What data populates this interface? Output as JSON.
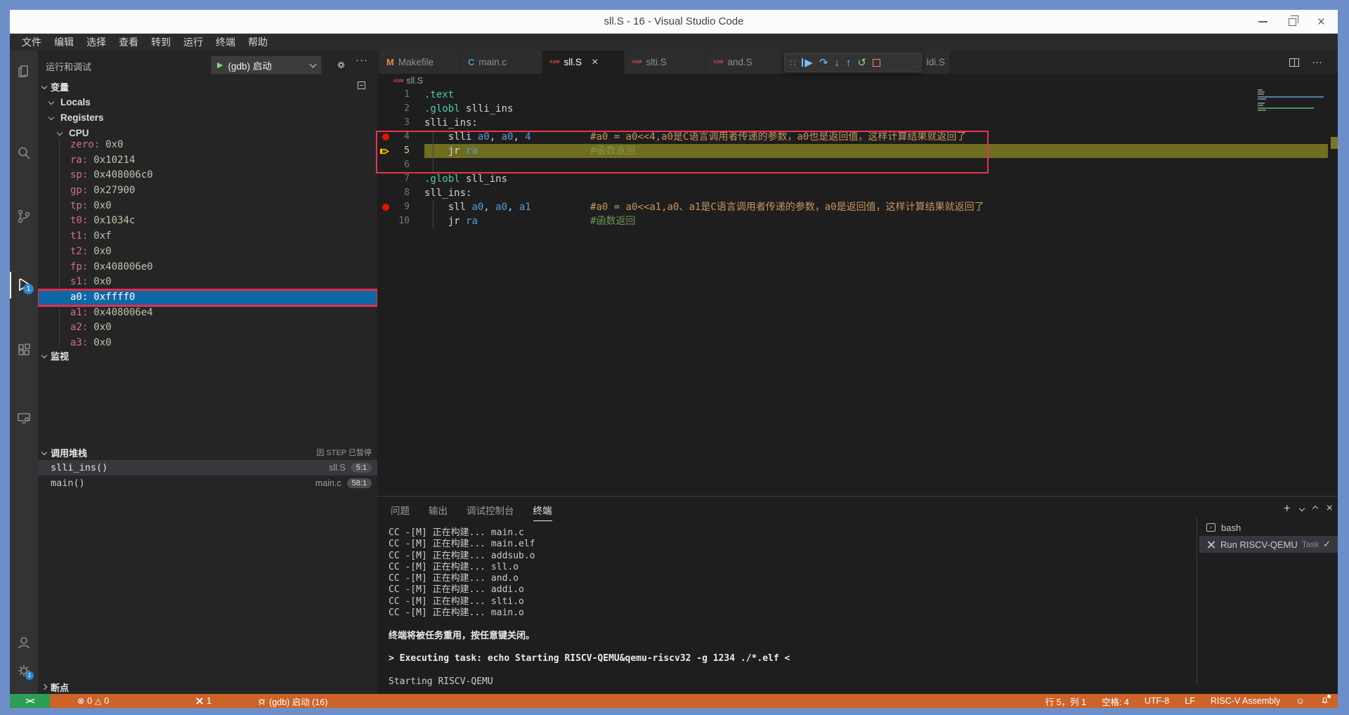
{
  "window": {
    "title": "sll.S - 16 - Visual Studio Code"
  },
  "menu": [
    "文件",
    "编辑",
    "选择",
    "查看",
    "转到",
    "运行",
    "终端",
    "帮助"
  ],
  "activity": {
    "debug_badge": "1",
    "settings_badge": "1"
  },
  "sidebar": {
    "title": "运行和调试",
    "launch": {
      "label": "(gdb) 启动"
    },
    "variables": {
      "title": "变量",
      "tree": [
        "Locals",
        "Registers"
      ],
      "cpu": "CPU",
      "registers": [
        [
          "zero",
          "0x0"
        ],
        [
          "ra",
          "0x10214"
        ],
        [
          "sp",
          "0x408006c0"
        ],
        [
          "gp",
          "0x27900"
        ],
        [
          "tp",
          "0x0"
        ],
        [
          "t0",
          "0x1034c"
        ],
        [
          "t1",
          "0xf"
        ],
        [
          "t2",
          "0x0"
        ],
        [
          "fp",
          "0x408006e0"
        ],
        [
          "s1",
          "0x0"
        ],
        [
          "a0",
          "0xffff0"
        ],
        [
          "a1",
          "0x408006e4"
        ],
        [
          "a2",
          "0x0"
        ],
        [
          "a3",
          "0x0"
        ]
      ],
      "selected": "a0"
    },
    "watch": {
      "title": "监视"
    },
    "call_stack": {
      "title": "调用堆栈",
      "paused_reason": "因 STEP 已暂停",
      "frames": [
        {
          "fn": "slli_ins()",
          "file": "sll.S",
          "pos": "5:1"
        },
        {
          "fn": "main()",
          "file": "main.c",
          "pos": "58:1"
        }
      ]
    },
    "breakpoints": {
      "title": "断点"
    }
  },
  "tabs": [
    {
      "icon": "M",
      "label": "Makefile"
    },
    {
      "icon": "C",
      "label": "main.c"
    },
    {
      "icon": "ASM",
      "label": "sll.S",
      "active": true
    },
    {
      "icon": "ASM",
      "label": "slti.S"
    },
    {
      "icon": "ASM",
      "label": "and.S"
    },
    {
      "icon": "ASM",
      "label": "ldi.S",
      "partial": true
    }
  ],
  "editor": {
    "breadcrumb": "sll.S",
    "lines": [
      {
        "n": 1,
        "segs": [
          [
            "dir",
            ".text"
          ]
        ]
      },
      {
        "n": 2,
        "segs": [
          [
            "dir",
            ".globl"
          ],
          [
            "pl",
            " slli_ins"
          ]
        ]
      },
      {
        "n": 3,
        "segs": [
          [
            "pl",
            "slli_ins:"
          ]
        ]
      },
      {
        "n": 4,
        "bp": true,
        "segs": [
          [
            "pl",
            "    slli "
          ],
          [
            "reg",
            "a0"
          ],
          [
            "pl",
            ", "
          ],
          [
            "reg",
            "a0"
          ],
          [
            "pl",
            ", "
          ],
          [
            "nm",
            "4"
          ],
          [
            "pl",
            "          "
          ],
          [
            "cmt1",
            "#a0 = a0<<4,a0是C语言调用者传递的参数，a0也是返回值，这样计算结果就返回了"
          ]
        ]
      },
      {
        "n": 5,
        "cur": true,
        "segs": [
          [
            "pl",
            "    jr "
          ],
          [
            "reg",
            "ra"
          ],
          [
            "pl",
            "                   "
          ],
          [
            "cmt2",
            "#函数返回"
          ]
        ]
      },
      {
        "n": 6,
        "segs": []
      },
      {
        "n": 7,
        "segs": [
          [
            "dir",
            ".globl"
          ],
          [
            "pl",
            " sll_ins"
          ]
        ]
      },
      {
        "n": 8,
        "segs": [
          [
            "pl",
            "sll_ins:"
          ]
        ]
      },
      {
        "n": 9,
        "bp": true,
        "segs": [
          [
            "pl",
            "    sll "
          ],
          [
            "reg",
            "a0"
          ],
          [
            "pl",
            ", "
          ],
          [
            "reg",
            "a0"
          ],
          [
            "pl",
            ", "
          ],
          [
            "reg",
            "a1"
          ],
          [
            "pl",
            "          "
          ],
          [
            "cmt1",
            "#a0 = a0<<a1,a0、a1是C语言调用者传递的参数，a0是返回值，这样计算结果就返回了"
          ]
        ]
      },
      {
        "n": 10,
        "segs": [
          [
            "pl",
            "    jr "
          ],
          [
            "reg",
            "ra"
          ],
          [
            "pl",
            "                   "
          ],
          [
            "cmt2",
            "#函数返回"
          ]
        ]
      }
    ]
  },
  "panel": {
    "tabs": [
      "问题",
      "输出",
      "调试控制台",
      "终端"
    ],
    "active_tab": "终端",
    "terminal": {
      "lines": [
        "CC -[M] 正在构建... main.c",
        "CC -[M] 正在构建... main.elf",
        "CC -[M] 正在构建... addsub.o",
        "CC -[M] 正在构建... sll.o",
        "CC -[M] 正在构建... and.o",
        "CC -[M] 正在构建... addi.o",
        "CC -[M] 正在构建... slti.o",
        "CC -[M] 正在构建... main.o",
        "",
        {
          "t": "终端将被任务重用，按任意键关闭。",
          "b": true
        },
        "",
        {
          "t": "> Executing task: echo Starting RISCV-QEMU&qemu-riscv32 -g 1234 ./*.elf <",
          "b": true
        },
        "",
        "Starting RISCV-QEMU"
      ]
    },
    "list": [
      {
        "label": "bash"
      },
      {
        "label": "Run RISCV-QEMU",
        "tag": "Task"
      }
    ]
  },
  "status": {
    "remote": "><",
    "errors": "0",
    "warnings": "0",
    "tasks": "1",
    "debug": "(gdb) 启动 (16)",
    "line_col": "行 5，列 1",
    "indent": "空格: 4",
    "encoding": "UTF-8",
    "eol": "LF",
    "lang": "RISC-V Assembly"
  }
}
